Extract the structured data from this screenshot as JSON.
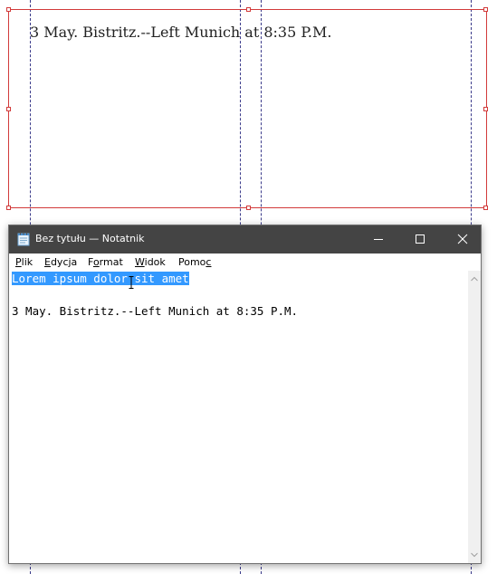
{
  "document": {
    "frame_text": "3 May. Bistritz.--Left Munich at 8:35 P.M."
  },
  "window": {
    "title": "Bez tytułu — Notatnik",
    "controls": {
      "minimize": "minimize-icon",
      "maximize": "maximize-icon",
      "close": "close-icon"
    }
  },
  "menu": {
    "items": [
      {
        "before": "",
        "key": "P",
        "after": "lik"
      },
      {
        "before": "",
        "key": "E",
        "after": "dycja"
      },
      {
        "before": "F",
        "key": "o",
        "after": "rmat"
      },
      {
        "before": "",
        "key": "W",
        "after": "idok"
      },
      {
        "before": "Pomo",
        "key": "c",
        "after": ""
      }
    ]
  },
  "editor": {
    "selected_line": "Lorem ipsum dolor sit amet",
    "blank_line": "",
    "body_line": "3 May. Bistritz.--Left Munich at 8:35 P.M."
  },
  "colors": {
    "selection": "#3399ff",
    "titlebar": "#444444",
    "frame_border": "#d23a3a"
  }
}
